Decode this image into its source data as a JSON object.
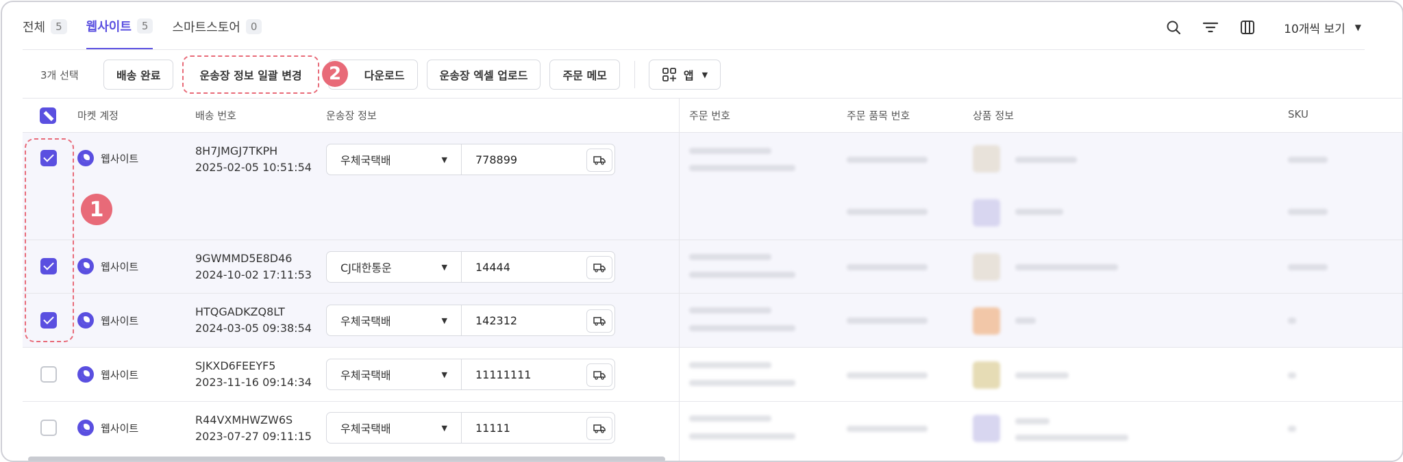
{
  "tabs": [
    {
      "label": "전체",
      "count": "5",
      "active": false
    },
    {
      "label": "웹사이트",
      "count": "5",
      "active": true
    },
    {
      "label": "스마트스토어",
      "count": "0",
      "active": false
    }
  ],
  "top_actions": {
    "per_page": "10개씩 보기"
  },
  "toolbar": {
    "selected_count": "3개 선택",
    "buttons": [
      "배송 완료",
      "운송장 정보 일괄 변경",
      "다운로드",
      "운송장 엑셀 업로드",
      "주문 메모"
    ],
    "app_label": "앱"
  },
  "badges": {
    "one": "1",
    "two": "2"
  },
  "columns": {
    "market": "마켓 계정",
    "ship_no": "배송 번호",
    "waybill": "운송장 정보",
    "order_no": "주문 번호",
    "order_item_no": "주문 품목 번호",
    "product": "상품 정보",
    "sku": "SKU"
  },
  "rows": [
    {
      "checked": true,
      "market": "웹사이트",
      "ship_no": "8H7JMGJ7TKPH",
      "date": "2025-02-05 10:51:54",
      "carrier": "우체국택배",
      "tracking": "778899"
    },
    {
      "checked": true,
      "market": "웹사이트",
      "ship_no": "9GWMMD5E8D46",
      "date": "2024-10-02 17:11:53",
      "carrier": "CJ대한통운",
      "tracking": "14444"
    },
    {
      "checked": true,
      "market": "웹사이트",
      "ship_no": "HTQGADKZQ8LT",
      "date": "2024-03-05 09:38:54",
      "carrier": "우체국택배",
      "tracking": "142312"
    },
    {
      "checked": false,
      "market": "웹사이트",
      "ship_no": "SJKXD6FEEYF5",
      "date": "2023-11-16 09:14:34",
      "carrier": "우체국택배",
      "tracking": "11111111"
    },
    {
      "checked": false,
      "market": "웹사이트",
      "ship_no": "R44VXMHWZW6S",
      "date": "2023-07-27 09:11:15",
      "carrier": "우체국택배",
      "tracking": "11111"
    }
  ],
  "colors": {
    "accent": "#5a4fe0",
    "highlight": "#e86a78"
  },
  "icons": [
    "search-icon",
    "filter-icon",
    "columns-icon",
    "chevron-down-icon",
    "apps-icon",
    "truck-icon"
  ]
}
